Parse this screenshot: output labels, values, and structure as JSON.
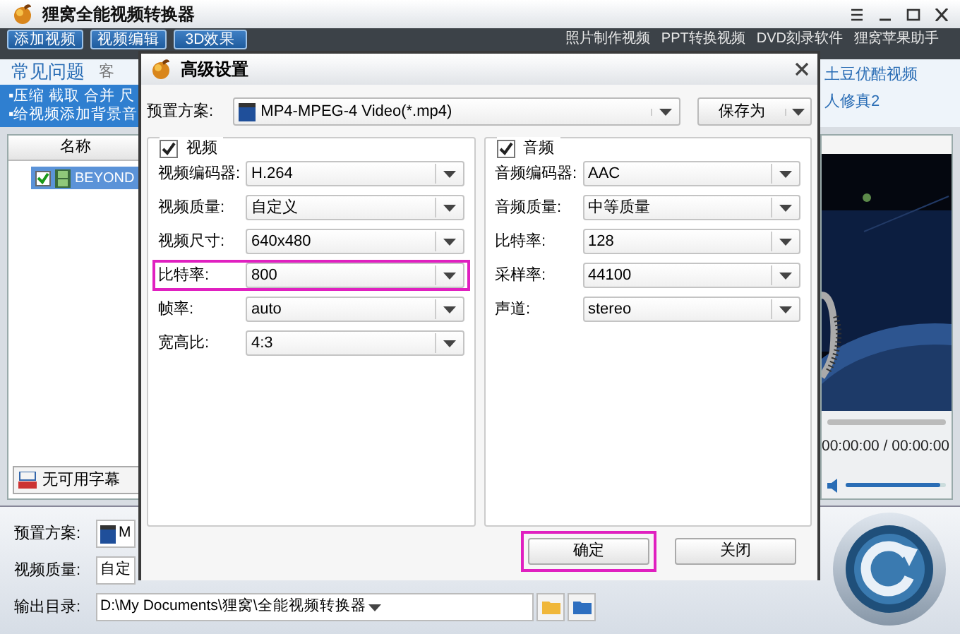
{
  "app": {
    "title": "狸窝全能视频转换器",
    "toolbar": [
      "添加视频",
      "视频编辑",
      "3D效果"
    ],
    "links": [
      "照片制作视频",
      "PPT转换视频",
      "DVD刻录软件",
      "狸窝苹果助手"
    ],
    "help": {
      "title": "常见问题",
      "tab": "客",
      "lines": [
        "▪压缩 截取 合并 尺",
        "▪给视频添加背景音"
      ],
      "right_links": [
        "土豆优酷视频",
        "人修真2"
      ]
    },
    "file_list": {
      "header": "名称",
      "items": [
        {
          "name": "BEYOND",
          "checked": true,
          "selected": true
        }
      ]
    },
    "subtitle": "无可用字幕",
    "player": {
      "time": "00:00:00 / 00:00:00",
      "volume": {
        "level": 0.95
      }
    },
    "settings": [
      {
        "label": "预置方案:",
        "value": "M"
      },
      {
        "label": "视频质量:",
        "value": "自定"
      },
      {
        "label": "输出目录:",
        "value": "D:\\My Documents\\狸窝\\全能视频转换器"
      }
    ]
  },
  "dialog": {
    "title": "高级设置",
    "preset": {
      "label": "预置方案:",
      "value": "MP4-MPEG-4 Video(*.mp4)"
    },
    "save_as": "保存为",
    "groups": [
      {
        "title": "视频",
        "checked": true,
        "fields": [
          {
            "label": "视频编码器:",
            "value": "H.264",
            "highlighted": false
          },
          {
            "label": "视频质量:",
            "value": "自定义",
            "highlighted": false
          },
          {
            "label": "视频尺寸:",
            "value": "640x480",
            "highlighted": false
          },
          {
            "label": "比特率:",
            "value": "800",
            "highlighted": true
          },
          {
            "label": "帧率:",
            "value": "auto",
            "highlighted": false
          },
          {
            "label": "宽高比:",
            "value": "4:3",
            "highlighted": false
          }
        ]
      },
      {
        "title": "音频",
        "checked": true,
        "fields": [
          {
            "label": "音频编码器:",
            "value": "AAC",
            "highlighted": false
          },
          {
            "label": "音频质量:",
            "value": "中等质量",
            "highlighted": false
          },
          {
            "label": "比特率:",
            "value": "128",
            "highlighted": false
          },
          {
            "label": "采样率:",
            "value": "44100",
            "highlighted": false
          },
          {
            "label": "声道:",
            "value": "stereo",
            "highlighted": false
          }
        ]
      }
    ],
    "buttons": [
      {
        "label": "确定",
        "highlighted": true
      },
      {
        "label": "关闭",
        "highlighted": false
      }
    ]
  }
}
